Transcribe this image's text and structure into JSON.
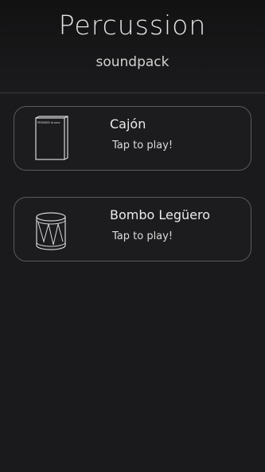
{
  "header": {
    "title": "Percussion",
    "subtitle": "soundpack"
  },
  "instruments": [
    {
      "name": "Cajón",
      "action": "Tap to play!",
      "icon": "cajon-icon",
      "brand_mark": "PREMIER drums"
    },
    {
      "name": "Bombo Legüero",
      "action": "Tap to play!",
      "icon": "drum-icon"
    }
  ],
  "colors": {
    "background": "#1a191b",
    "card_border": "#5a595c",
    "text": "#e8e8e8"
  }
}
